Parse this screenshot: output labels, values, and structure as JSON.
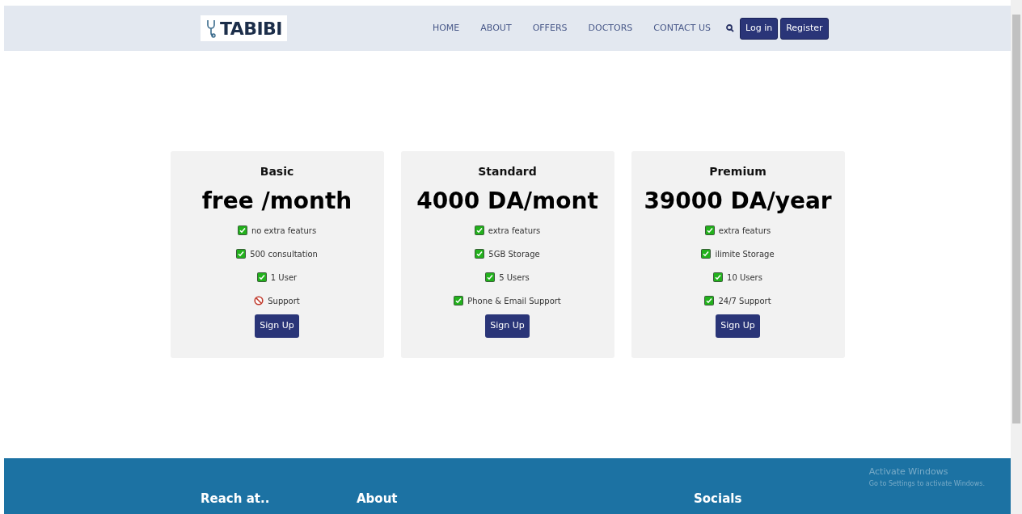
{
  "brand": "TABIBI",
  "nav": {
    "links": [
      {
        "label": "HOME"
      },
      {
        "label": "ABOUT"
      },
      {
        "label": "OFFERS"
      },
      {
        "label": "DOCTORS"
      },
      {
        "label": "CONTACT US"
      }
    ],
    "buttons": [
      "Log in",
      "Register"
    ]
  },
  "plans": [
    {
      "name": "Basic",
      "price": "free /month",
      "features": [
        {
          "text": "no extra featurs",
          "included": true
        },
        {
          "text": "500 consultation",
          "included": true
        },
        {
          "text": "1 User",
          "included": true
        },
        {
          "text": "Support",
          "included": false
        }
      ],
      "button": "Sign Up"
    },
    {
      "name": "Standard",
      "price": "4000 DA/mont",
      "features": [
        {
          "text": "extra featurs",
          "included": true
        },
        {
          "text": "5GB Storage",
          "included": true
        },
        {
          "text": "5 Users",
          "included": true
        },
        {
          "text": "Phone & Email Support",
          "included": true
        }
      ],
      "button": "Sign Up"
    },
    {
      "name": "Premium",
      "price": "39000 DA/year",
      "features": [
        {
          "text": "extra featurs",
          "included": true
        },
        {
          "text": "ilimite Storage",
          "included": true
        },
        {
          "text": "10 Users",
          "included": true
        },
        {
          "text": "24/7 Support",
          "included": true
        }
      ],
      "button": "Sign Up"
    }
  ],
  "footer": {
    "headings": [
      "Reach at..",
      "About",
      "Socials"
    ]
  },
  "os_notice": {
    "title": "Activate Windows",
    "subtitle": "Go to Settings to activate Windows."
  }
}
